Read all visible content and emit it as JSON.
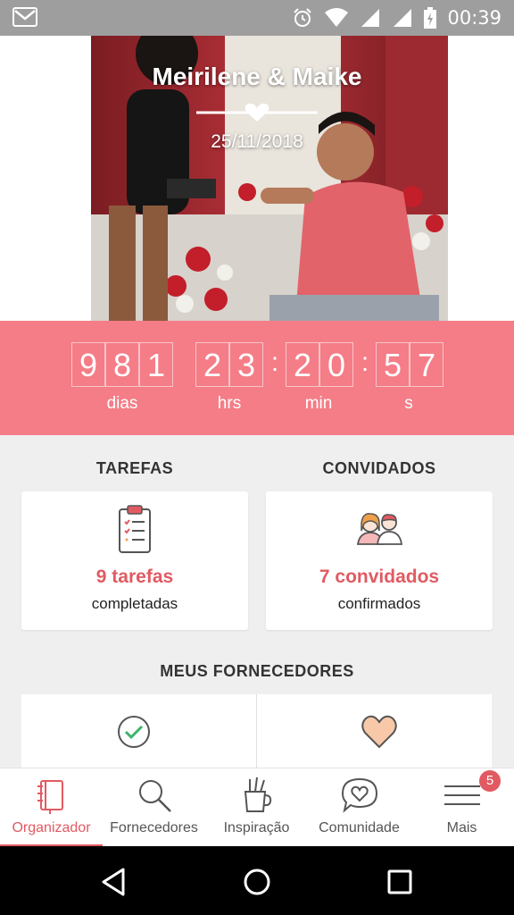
{
  "status_bar": {
    "time": "00:39",
    "icons": [
      "gmail-icon",
      "alarm-icon",
      "wifi-icon",
      "signal-icon",
      "signal-icon",
      "battery-icon"
    ]
  },
  "hero": {
    "couple_names": "Meirilene & Maike",
    "wedding_date": "25/11/2018"
  },
  "countdown": {
    "days_digits": [
      "9",
      "8",
      "1"
    ],
    "hours_digits": [
      "2",
      "3"
    ],
    "minutes_digits": [
      "2",
      "0"
    ],
    "seconds_digits": [
      "5",
      "7"
    ],
    "separator": ":",
    "labels": {
      "days": "dias",
      "hours": "hrs",
      "minutes": "min",
      "seconds": "s"
    }
  },
  "tasks": {
    "heading": "TAREFAS",
    "count_text": "9 tarefas",
    "sub_text": "completadas"
  },
  "guests": {
    "heading": "CONVIDADOS",
    "count_text": "7 convidados",
    "sub_text": "confirmados"
  },
  "vendors": {
    "heading": "MEUS FORNECEDORES"
  },
  "bottom_nav": {
    "items": [
      {
        "label": "Organizador",
        "icon": "notebook-icon",
        "active": true
      },
      {
        "label": "Fornecedores",
        "icon": "search-icon",
        "active": false
      },
      {
        "label": "Inspiração",
        "icon": "pencil-cup-icon",
        "active": false
      },
      {
        "label": "Comunidade",
        "icon": "chat-heart-icon",
        "active": false
      },
      {
        "label": "Mais",
        "icon": "menu-icon",
        "active": false
      }
    ],
    "badge": "5"
  },
  "colors": {
    "accent": "#e15a62",
    "countdown_bg": "#f47d87",
    "background": "#efefef"
  }
}
